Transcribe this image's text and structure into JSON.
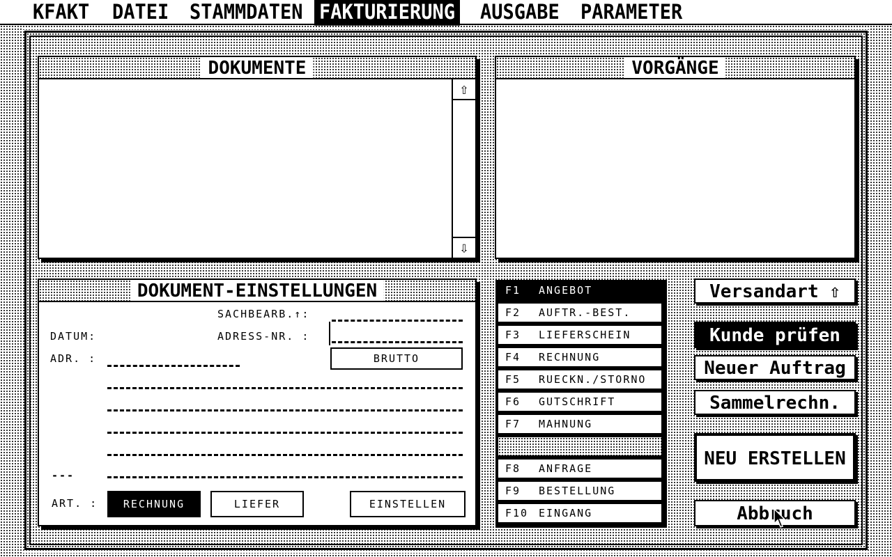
{
  "menubar": {
    "items": [
      "KFAKT",
      "DATEI",
      "STAMMDATEN",
      "FAKTURIERUNG",
      "AUSGABE",
      "PARAMETER"
    ],
    "active": "FAKTURIERUNG"
  },
  "dokumente": {
    "title": "DOKUMENTE",
    "scroll_up": "⇧",
    "scroll_down": "⇩"
  },
  "vorgaenge": {
    "title": "VORGÄNGE"
  },
  "einstellungen": {
    "title": "DOKUMENT-EINSTELLUNGEN",
    "sachbearb_label": "SACHBEARB.↑:",
    "datum_label": "DATUM:",
    "adress_nr_label": "ADRESS-NR. :",
    "adr_label": "ADR. :",
    "brutto_button": "BRUTTO",
    "art_label": "ART. :",
    "rechnung_button": "RECHNUNG",
    "liefer_button": "LIEFER",
    "einstellen_button": "EINSTELLEN",
    "prefix_dashes": "---"
  },
  "fkeys": [
    {
      "key": "F1",
      "label": "ANGEBOT",
      "selected": true
    },
    {
      "key": "F2",
      "label": "AUFTR.-BEST."
    },
    {
      "key": "F3",
      "label": "LIEFERSCHEIN"
    },
    {
      "key": "F4",
      "label": "RECHNUNG"
    },
    {
      "key": "F5",
      "label": "RUECKN./STORNO"
    },
    {
      "key": "F6",
      "label": "GUTSCHRIFT"
    },
    {
      "key": "F7",
      "label": "MAHNUNG"
    },
    {
      "key": "F8",
      "label": "ANFRAGE"
    },
    {
      "key": "F9",
      "label": "BESTELLUNG"
    },
    {
      "key": "F10",
      "label": "EINGANG"
    }
  ],
  "actions": {
    "versandart": "Versandart ⇧",
    "kunde_pruefen": "Kunde prüfen",
    "neuer_auftrag": "Neuer Auftrag",
    "sammelrechn": "Sammelrechn.",
    "neu_erstellen": "NEU ERSTELLEN",
    "abbruch": "Abbruch"
  }
}
